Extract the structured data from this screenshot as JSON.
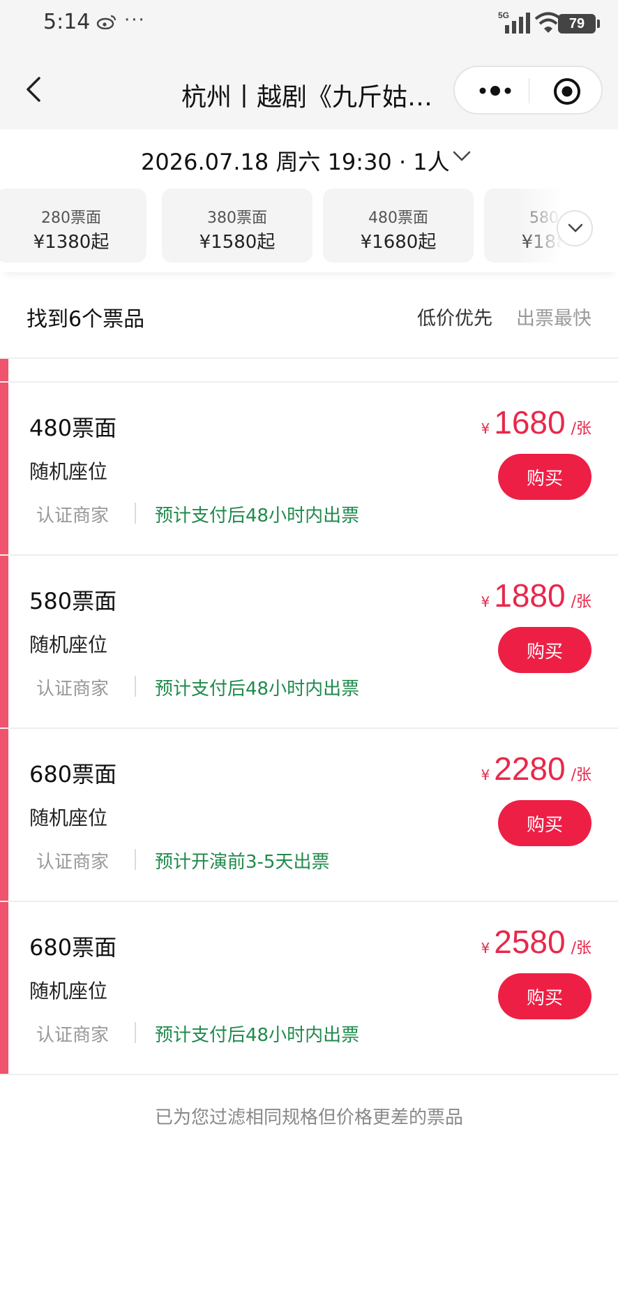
{
  "status": {
    "time": "5:14",
    "more": "···",
    "battery": "79",
    "network": "5G"
  },
  "header": {
    "title": "杭州丨越剧《九斤姑…"
  },
  "session": {
    "label": "2026.07.18 周六 19:30 · 1人"
  },
  "price_tabs": [
    {
      "face": "280票面",
      "from": "¥1380起"
    },
    {
      "face": "380票面",
      "from": "¥1580起"
    },
    {
      "face": "480票面",
      "from": "¥1680起"
    },
    {
      "face": "580票面",
      "from": "¥1880起"
    }
  ],
  "results": {
    "count_label": "找到6个票品",
    "sort_price": "低价优先",
    "sort_speed": "出票最快"
  },
  "tickets": [
    {
      "name": "480票面",
      "seat": "随机座位",
      "merchant": "认证商家",
      "eta": "预计支付后48小时内出票",
      "currency": "¥",
      "price": "1680",
      "unit": "/张",
      "buy": "购买"
    },
    {
      "name": "580票面",
      "seat": "随机座位",
      "merchant": "认证商家",
      "eta": "预计支付后48小时内出票",
      "currency": "¥",
      "price": "1880",
      "unit": "/张",
      "buy": "购买"
    },
    {
      "name": "680票面",
      "seat": "随机座位",
      "merchant": "认证商家",
      "eta": "预计开演前3-5天出票",
      "currency": "¥",
      "price": "2280",
      "unit": "/张",
      "buy": "购买"
    },
    {
      "name": "680票面",
      "seat": "随机座位",
      "merchant": "认证商家",
      "eta": "预计支付后48小时内出票",
      "currency": "¥",
      "price": "2580",
      "unit": "/张",
      "buy": "购买"
    }
  ],
  "footer": {
    "note": "已为您过滤相同规格但价格更差的票品"
  },
  "colors": {
    "accent": "#ee1f45",
    "price": "#e8284a",
    "eta_green": "#1f8a4c",
    "side_bar": "#f0536e"
  }
}
